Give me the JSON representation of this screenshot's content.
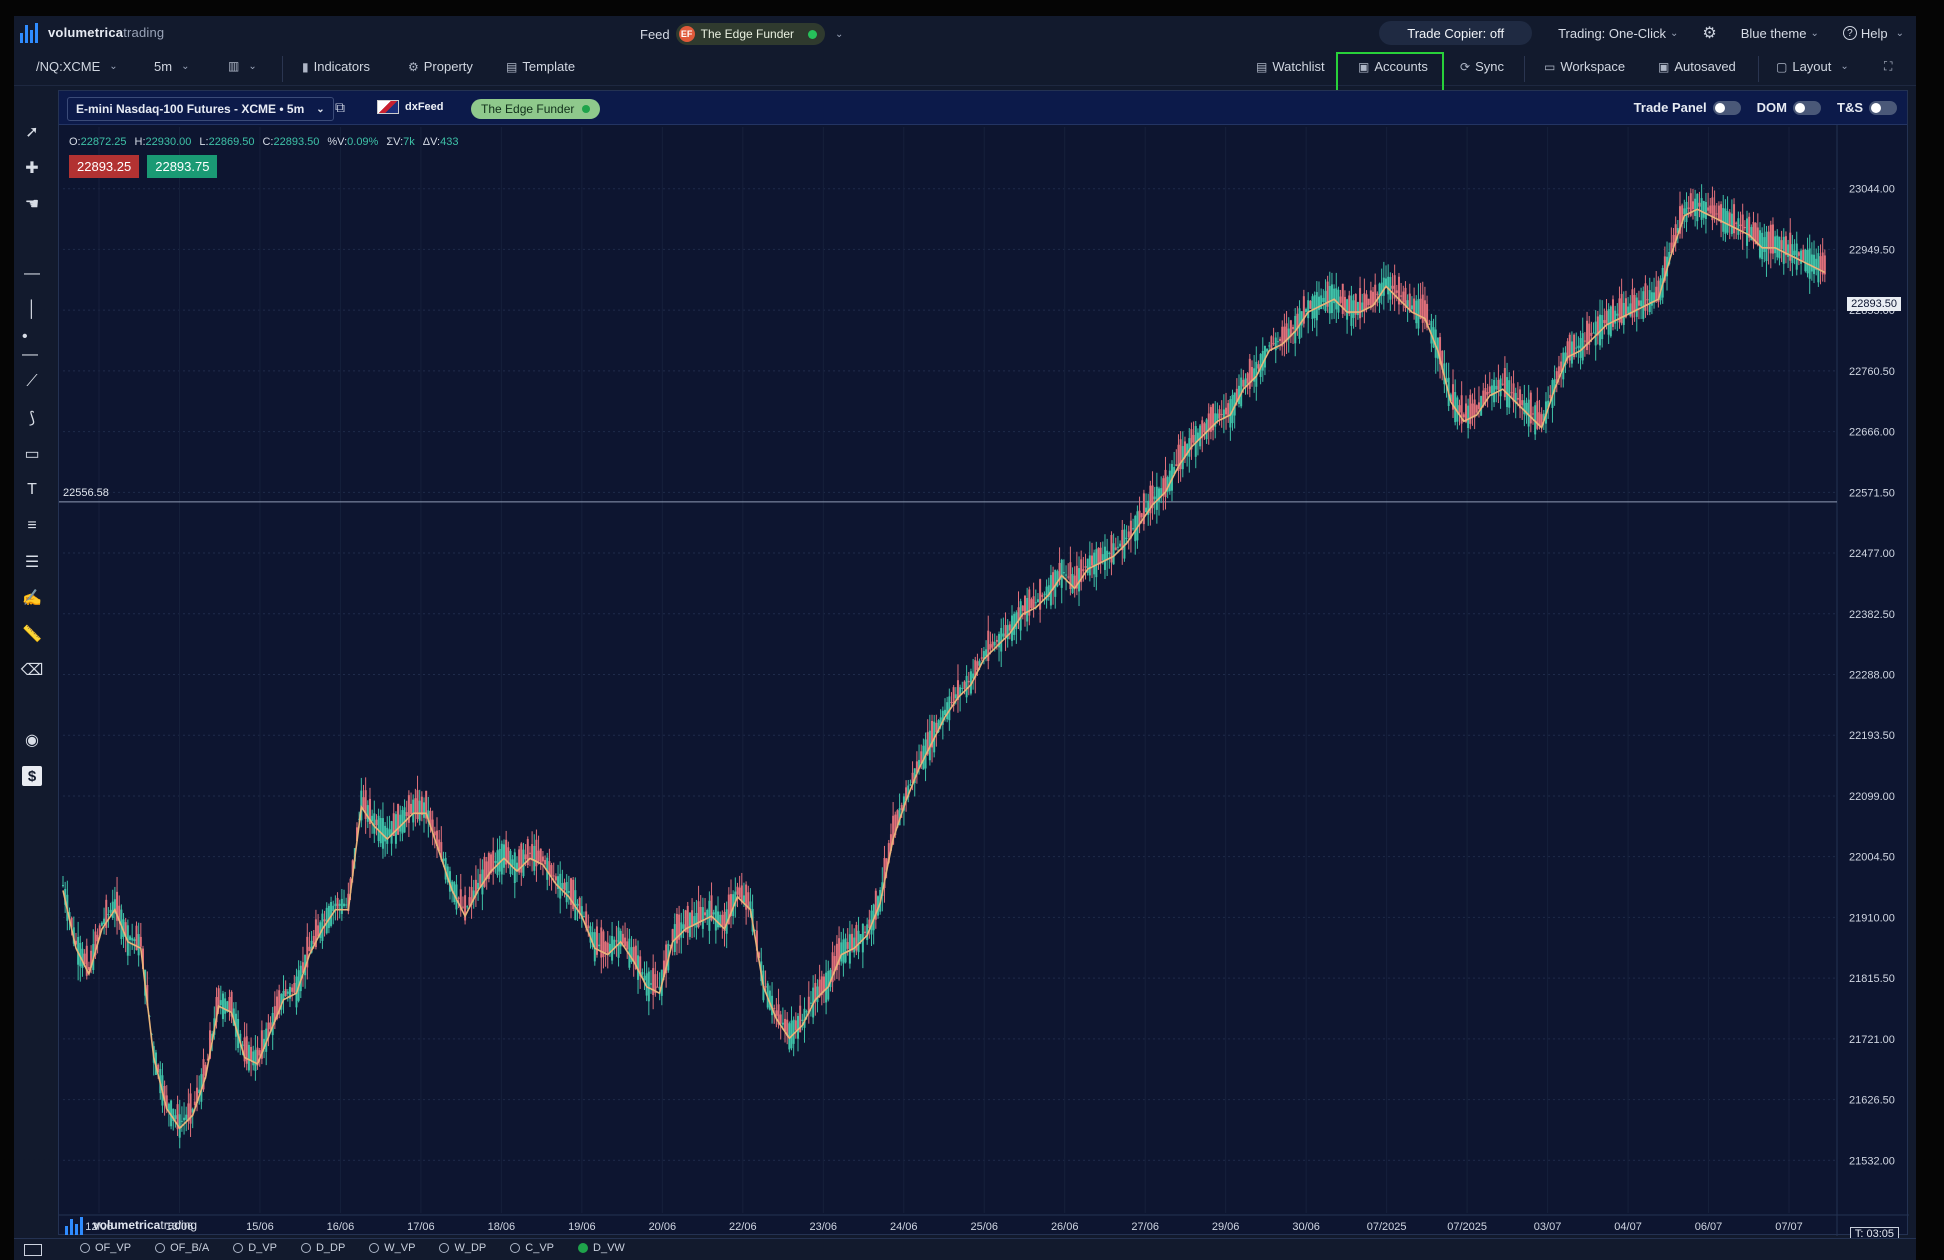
{
  "app": {
    "logo_bold": "volumetrica",
    "logo_light": "trading"
  },
  "topbar": {
    "feed_label": "Feed",
    "feed_account": "The Edge Funder",
    "feed_flag": "EF",
    "trade_copier": "Trade Copier: off",
    "trading_mode": "Trading: One-Click",
    "theme": "Blue theme",
    "help": "Help"
  },
  "toolbar": {
    "symbol": "/NQ:XCME",
    "timeframe": "5m",
    "indicators": "Indicators",
    "property": "Property",
    "template": "Template",
    "watchlist": "Watchlist",
    "accounts": "Accounts",
    "sync": "Sync",
    "workspace": "Workspace",
    "autosaved": "Autosaved",
    "layout": "Layout"
  },
  "chart_header": {
    "instrument": "E-mini Nasdaq-100 Futures - XCME • 5m",
    "datafeed": "dxFeed",
    "account": "The Edge Funder",
    "trade_panel": "Trade Panel",
    "dom": "DOM",
    "ts": "T&S"
  },
  "ohlc": {
    "o_label": "O:",
    "o": "22872.25",
    "h_label": "H:",
    "h": "22930.00",
    "l_label": "L:",
    "l": "22869.50",
    "c_label": "C:",
    "c": "22893.50",
    "pv_label": "%V:",
    "pv": "0.09%",
    "sv_label": "ΣV:",
    "sv": "7k",
    "dv_label": "ΔV:",
    "dv": "433"
  },
  "quote": {
    "bid": "22893.25",
    "ask": "22893.75"
  },
  "horizontal_line_label": "22556.58",
  "last_price_tag": "22893.50",
  "timer": "T: 03:05",
  "watermark_bold": "volumetrica",
  "watermark_light": "trading",
  "colors": {
    "background": "#0d1530",
    "up_candle": "#3ec1a7",
    "down_candle": "#e0707a",
    "moving_average": "#e8b47a",
    "accounts_highlight": "#28d13a"
  },
  "bottom_tabs": [
    {
      "label": "OF_VP",
      "selected": false
    },
    {
      "label": "OF_B/A",
      "selected": false
    },
    {
      "label": "D_VP",
      "selected": false
    },
    {
      "label": "D_DP",
      "selected": false
    },
    {
      "label": "W_VP",
      "selected": false
    },
    {
      "label": "W_DP",
      "selected": false
    },
    {
      "label": "C_VP",
      "selected": false
    },
    {
      "label": "D_VW",
      "selected": true
    }
  ],
  "sidebar_tools": [
    "cursor-icon",
    "crosshair-icon",
    "hand-icon",
    "horizontal-line-icon",
    "vertical-line-icon",
    "ray-icon",
    "trend-line-icon",
    "path-icon",
    "rectangle-icon",
    "text-icon",
    "list-icon",
    "lines-icon",
    "pen-icon",
    "ruler-icon",
    "eraser-icon",
    "eye-icon",
    "dollar-icon"
  ],
  "chart_data": {
    "type": "line",
    "ylim": [
      21450,
      23140
    ],
    "y_ticks": [
      "23044.00",
      "22949.50",
      "22855.00",
      "22760.50",
      "22666.00",
      "22571.50",
      "22477.00",
      "22382.50",
      "22288.00",
      "22193.50",
      "22099.00",
      "22004.50",
      "21910.00",
      "21815.50",
      "21721.00",
      "21626.50",
      "21532.00"
    ],
    "x_ticks": [
      "12/06",
      "13/06",
      "15/06",
      "16/06",
      "17/06",
      "18/06",
      "19/06",
      "20/06",
      "22/06",
      "23/06",
      "24/06",
      "25/06",
      "26/06",
      "27/06",
      "29/06",
      "30/06",
      "07/2025",
      "07/2025",
      "03/07",
      "04/07",
      "06/07",
      "07/07"
    ],
    "series": [
      {
        "values": [
          21960,
          21870,
          21830,
          21900,
          21930,
          21880,
          21870,
          21700,
          21620,
          21590,
          21610,
          21670,
          21780,
          21770,
          21700,
          21690,
          21740,
          21790,
          21800,
          21860,
          21900,
          21930,
          21930,
          22090,
          22060,
          22040,
          22060,
          22080,
          22080,
          22020,
          21960,
          21920,
          21960,
          21990,
          22010,
          21990,
          22010,
          22000,
          21970,
          21950,
          21920,
          21870,
          21860,
          21880,
          21850,
          21810,
          21800,
          21880,
          21900,
          21910,
          21920,
          21900,
          21950,
          21930,
          21810,
          21760,
          21730,
          21750,
          21790,
          21810,
          21860,
          21870,
          21890,
          21940,
          22040,
          22100,
          22150,
          22190,
          22230,
          22260,
          22280,
          22320,
          22340,
          22360,
          22390,
          22400,
          22420,
          22450,
          22430,
          22460,
          22470,
          22480,
          22500,
          22530,
          22560,
          22580,
          22620,
          22650,
          22670,
          22690,
          22700,
          22740,
          22760,
          22800,
          22810,
          22830,
          22860,
          22870,
          22880,
          22860,
          22860,
          22870,
          22900,
          22880,
          22860,
          22850,
          22800,
          22720,
          22690,
          22700,
          22730,
          22740,
          22720,
          22700,
          22680,
          22740,
          22790,
          22800,
          22820,
          22840,
          22850,
          22860,
          22870,
          22880,
          22950,
          23010,
          23020,
          23010,
          23000,
          22990,
          22980,
          22960,
          22960,
          22950,
          22940,
          22930,
          22920
        ]
      }
    ]
  }
}
